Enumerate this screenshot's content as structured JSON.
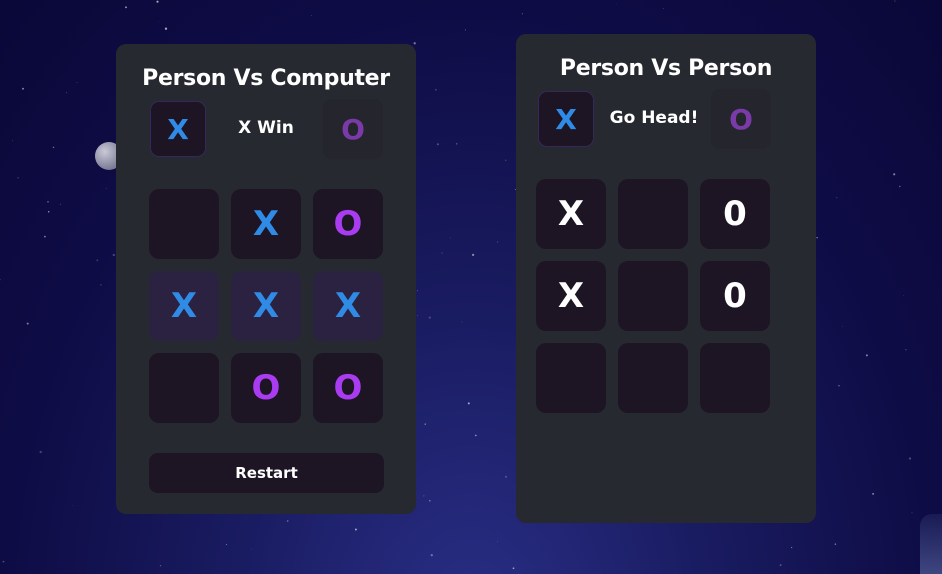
{
  "colors": {
    "x_mark": "#2f8be6",
    "o_mark": "#a93cf0",
    "o_turn_dim": "#7a3aa8",
    "panel_bg": "#262930",
    "cell_bg": "#1d1424",
    "win_cell_bg": "#2a2240"
  },
  "pvc": {
    "title": "Person Vs Computer",
    "turn_x": "X",
    "turn_o": "O",
    "status": "X Win",
    "cells": [
      "",
      "X",
      "O",
      "X",
      "X",
      "X",
      "",
      "O",
      "O"
    ],
    "winning_cells": [
      3,
      4,
      5
    ],
    "restart_label": "Restart"
  },
  "pvp": {
    "title": "Person Vs Person",
    "turn_x": "X",
    "turn_o": "O",
    "status": "Go Head!",
    "cells": [
      "X",
      "",
      "0",
      "X",
      "",
      "0",
      "",
      "",
      ""
    ]
  }
}
